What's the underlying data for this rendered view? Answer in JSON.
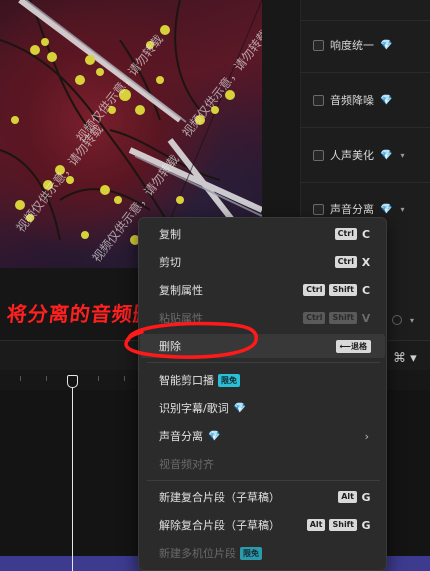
{
  "preview": {
    "watermark": "视频仅供示意，请勿转载"
  },
  "right_panel": {
    "items": [
      {
        "label": "响度统一",
        "premium": "💎",
        "dropdown": ""
      },
      {
        "label": "音频降噪",
        "premium": "💎",
        "dropdown": ""
      },
      {
        "label": "人声美化",
        "premium": "💎",
        "dropdown": "▾"
      },
      {
        "label": "声音分离",
        "premium": "💎",
        "dropdown": "▾"
      }
    ]
  },
  "annotation": {
    "text": "将分离的音频删除",
    "color": "#ff2020"
  },
  "context_menu": {
    "items": [
      {
        "label": "复制",
        "modifiers": [
          "Ctrl"
        ],
        "key": "C",
        "disabled": false
      },
      {
        "label": "剪切",
        "modifiers": [
          "Ctrl"
        ],
        "key": "X",
        "disabled": false
      },
      {
        "label": "复制属性",
        "modifiers": [
          "Ctrl",
          "Shift"
        ],
        "key": "C",
        "disabled": false
      },
      {
        "label": "粘贴属性",
        "modifiers": [
          "Ctrl",
          "Shift"
        ],
        "key": "V",
        "disabled": true
      },
      {
        "label": "删除",
        "shortcut": "⟵退格",
        "disabled": false,
        "highlighted": true
      },
      {
        "label": "智能剪口播",
        "badge": "限免",
        "disabled": false
      },
      {
        "label": "识别字幕/歌词",
        "premium": "💎",
        "disabled": false
      },
      {
        "label": "声音分离",
        "premium": "💎",
        "submenu": "›",
        "disabled": false
      },
      {
        "label": "视音频对齐",
        "disabled": true
      },
      {
        "label": "新建复合片段（子草稿）",
        "modifiers": [
          "Alt"
        ],
        "key": "G",
        "disabled": false
      },
      {
        "label": "解除复合片段（子草稿）",
        "modifiers": [
          "Alt",
          "Shift"
        ],
        "key": "G",
        "disabled": false
      },
      {
        "label": "新建多机位片段",
        "badge": "限免",
        "disabled": true
      }
    ]
  },
  "timeline": {
    "tool_icon": "⌘ ▾"
  },
  "colors": {
    "menu_bg": "#2b2b2b",
    "accent": "#2bbfd8",
    "clip": "#3d3b8f"
  }
}
